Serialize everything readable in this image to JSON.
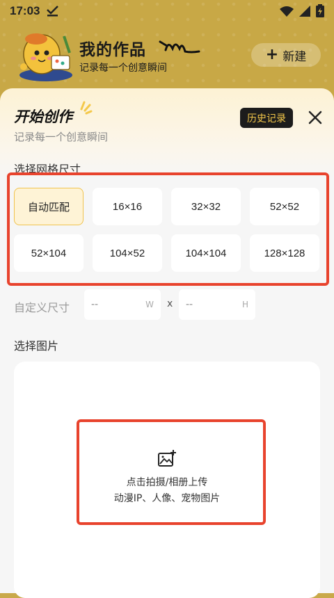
{
  "status_bar": {
    "time": "17:03"
  },
  "header": {
    "title": "我的作品",
    "subtitle": "记录每一个创意瞬间",
    "new_button": "新建"
  },
  "sheet": {
    "title": "开始创作",
    "subtitle": "记录每一个创意瞬间",
    "history_button": "历史记录",
    "grid_section_label": "选择网格尺寸",
    "size_options": [
      "自动匹配",
      "16×16",
      "32×32",
      "52×52",
      "52×104",
      "104×52",
      "104×104",
      "128×128"
    ],
    "selected_size": "自动匹配",
    "custom_size": {
      "label": "自定义尺寸",
      "width_placeholder": "--",
      "width_unit": "W",
      "separator": "x",
      "height_placeholder": "--",
      "height_unit": "H"
    },
    "image_section_label": "选择图片",
    "upload": {
      "line1": "点击拍摄/相册上传",
      "line2": "动漫IP、人像、宠物图片"
    }
  },
  "colors": {
    "header_bg": "#c8a846",
    "accent_yellow": "#f4c84a",
    "highlight_red": "#e8432d",
    "selected_bg": "#fef3d6"
  }
}
